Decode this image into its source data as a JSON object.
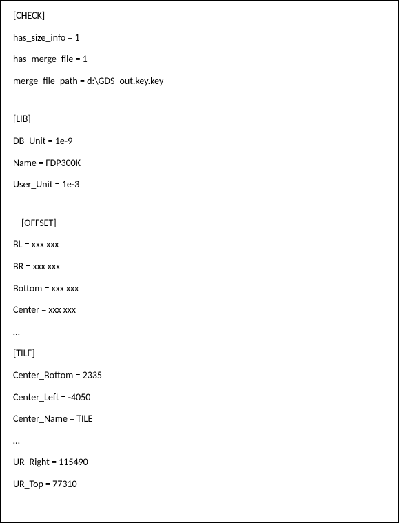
{
  "lines": {
    "l0": "[CHECK]",
    "l1": "has_size_info = 1",
    "l2": "has_merge_file = 1",
    "l3": "merge_file_path = d:\\GDS_out.key.key",
    "l4": "[LIB]",
    "l5": "DB_Unit = 1e-9",
    "l6": "Name = FDP300K",
    "l7": "User_Unit = 1e-3",
    "l8": "[OFFSET]",
    "l9": "BL = xxx xxx",
    "l10": "BR = xxx xxx",
    "l11": "Bottom = xxx xxx",
    "l12": "Center = xxx xxx",
    "l13": "…",
    "l14": "[TILE]",
    "l15": "Center_Bottom = 2335",
    "l16": "Center_Left = -4050",
    "l17": "Center_Name = TILE",
    "l18": "…",
    "l19": "UR_Right = 115490",
    "l20": "UR_Top = 77310"
  }
}
